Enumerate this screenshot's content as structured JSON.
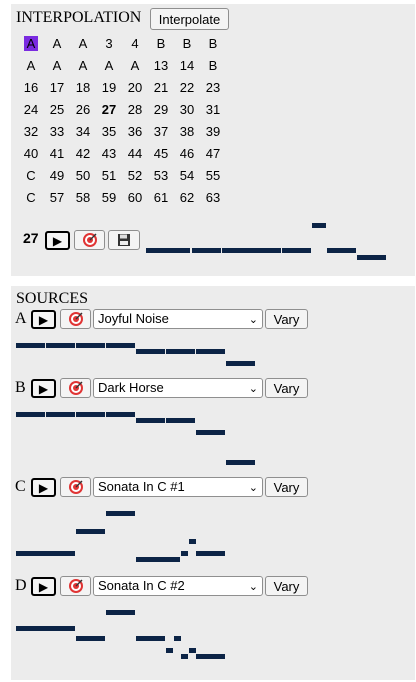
{
  "interpolation": {
    "title": "INTERPOLATION",
    "interpolate_label": "Interpolate",
    "grid": [
      [
        "A",
        "A",
        "A",
        "3",
        "4",
        "B",
        "B",
        "B"
      ],
      [
        "A",
        "A",
        "A",
        "A",
        "A",
        "13",
        "14",
        "B"
      ],
      [
        "16",
        "17",
        "18",
        "19",
        "20",
        "21",
        "22",
        "23"
      ],
      [
        "24",
        "25",
        "26",
        "27",
        "28",
        "29",
        "30",
        "31"
      ],
      [
        "32",
        "33",
        "34",
        "35",
        "36",
        "37",
        "38",
        "39"
      ],
      [
        "40",
        "41",
        "42",
        "43",
        "44",
        "45",
        "46",
        "47"
      ],
      [
        "C",
        "49",
        "50",
        "51",
        "52",
        "53",
        "54",
        "55"
      ],
      [
        "C",
        "57",
        "58",
        "59",
        "60",
        "61",
        "62",
        "63"
      ]
    ],
    "selected_cell": "0,0",
    "bold_cell": "3,3",
    "current": "27",
    "play_icon": "play-icon",
    "record_icon": "target-icon",
    "save_icon": "floppy-icon"
  },
  "sources": {
    "title": "SOURCES",
    "items": [
      {
        "letter": "A",
        "selected": "Joyful Noise",
        "vary_label": "Vary"
      },
      {
        "letter": "B",
        "selected": "Dark Horse",
        "vary_label": "Vary"
      },
      {
        "letter": "C",
        "selected": "Sonata In C #1",
        "vary_label": "Vary"
      },
      {
        "letter": "D",
        "selected": "Sonata In C #2",
        "vary_label": "Vary"
      }
    ]
  },
  "colors": {
    "selected_cell": "#7a2be0",
    "note": "#0c2446",
    "panel": "#ececec"
  }
}
